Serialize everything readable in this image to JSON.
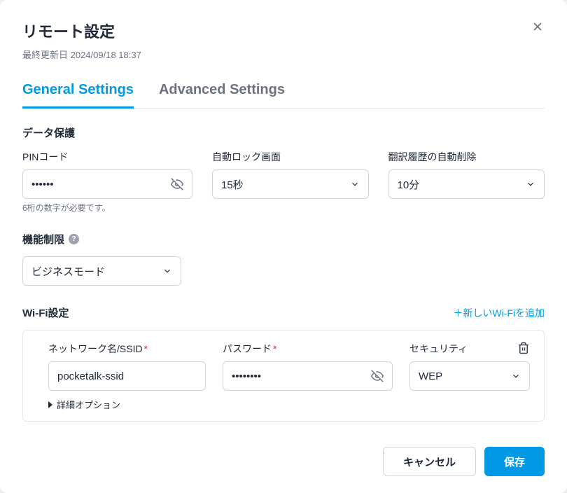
{
  "modal": {
    "title": "リモート設定",
    "subtitle": "最終更新日 2024/09/18 18:37"
  },
  "tabs": {
    "general": "General Settings",
    "advanced": "Advanced Settings"
  },
  "sections": {
    "data_protection": "データ保護",
    "function_limit": "機能制限",
    "wifi": "Wi-Fi設定"
  },
  "fields": {
    "pin": {
      "label": "PINコード",
      "value": "••••••",
      "helper": "6桁の数字が必要です。"
    },
    "auto_lock": {
      "label": "自動ロック画面",
      "value": "15秒"
    },
    "auto_delete": {
      "label": "翻訳履歴の自動削除",
      "value": "10分"
    },
    "mode": {
      "value": "ビジネスモード"
    }
  },
  "wifi": {
    "add_label": "＋新しいWi-Fiを追加",
    "ssid": {
      "label": "ネットワーク名/SSID",
      "value": "pocketalk-ssid"
    },
    "password": {
      "label": "パスワード",
      "value": "••••••••"
    },
    "security": {
      "label": "セキュリティ",
      "value": "WEP"
    },
    "detail": "詳細オプション"
  },
  "buttons": {
    "cancel": "キャンセル",
    "save": "保存"
  }
}
